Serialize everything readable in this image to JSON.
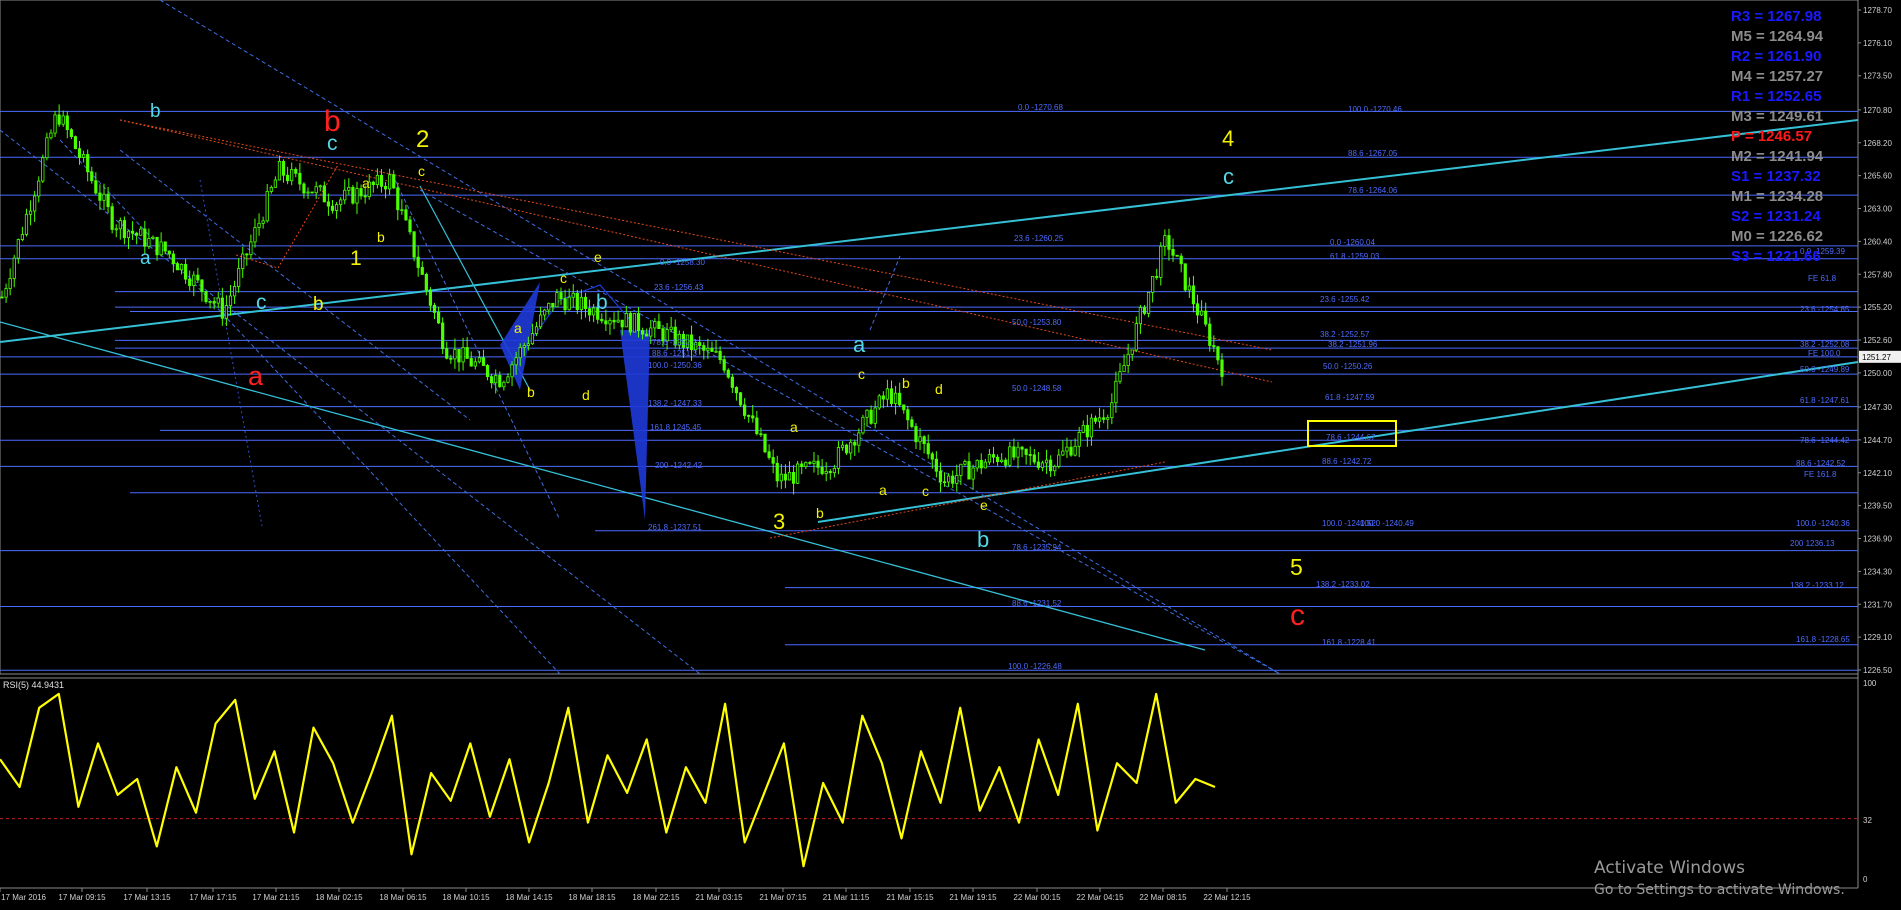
{
  "indicator": {
    "label": "RSI(5) 44.9431",
    "levels": {
      "hi": "100",
      "mid": "32",
      "lo": "0"
    }
  },
  "x_ticks": [
    "17 Mar 2016",
    "17 Mar 09:15",
    "17 Mar 13:15",
    "17 Mar 17:15",
    "17 Mar 21:15",
    "18 Mar 02:15",
    "18 Mar 06:15",
    "18 Mar 10:15",
    "18 Mar 14:15",
    "18 Mar 18:15",
    "18 Mar 22:15",
    "21 Mar 03:15",
    "21 Mar 07:15",
    "21 Mar 11:15",
    "21 Mar 15:15",
    "21 Mar 19:15",
    "22 Mar 00:15",
    "22 Mar 04:15",
    "22 Mar 08:15",
    "22 Mar 12:15"
  ],
  "pivots": [
    {
      "label": "R3 = 1267.98",
      "color": "#1a1aff"
    },
    {
      "label": "M5 = 1264.94",
      "color": "#8c8c8c"
    },
    {
      "label": "R2 = 1261.90",
      "color": "#1a1aff"
    },
    {
      "label": "M4 = 1257.27",
      "color": "#8c8c8c"
    },
    {
      "label": "R1 = 1252.65",
      "color": "#1a1aff"
    },
    {
      "label": "M3 = 1249.61",
      "color": "#8c8c8c"
    },
    {
      "label": "P = 1246.57",
      "color": "#ff1a1a"
    },
    {
      "label": "M2 = 1241.94",
      "color": "#8c8c8c"
    },
    {
      "label": "S1 = 1237.32",
      "color": "#1a1aff"
    },
    {
      "label": "M1 = 1234.28",
      "color": "#8c8c8c"
    },
    {
      "label": "S2 = 1231.24",
      "color": "#1a1aff"
    },
    {
      "label": "M0 = 1226.62",
      "color": "#8c8c8c"
    },
    {
      "label": "S3 = 1221.66",
      "color": "#1a1aff"
    }
  ],
  "wave_labels": [
    {
      "t": "b",
      "color": "#55d6e6"
    },
    {
      "t": "b",
      "color": "#ff2020"
    },
    {
      "t": "c",
      "color": "#55d6e6"
    },
    {
      "t": "2",
      "color": "#f2f200"
    },
    {
      "t": "c",
      "color": "#f2f200"
    },
    {
      "t": "a",
      "color": "#55d6e6"
    },
    {
      "t": "1",
      "color": "#f2f200"
    },
    {
      "t": "b",
      "color": "#f2f200"
    },
    {
      "t": "a",
      "color": "#f2f200"
    },
    {
      "t": "b",
      "color": "#f2f200"
    },
    {
      "t": "c",
      "color": "#55d6e6"
    },
    {
      "t": "b",
      "color": "#55d6e6"
    },
    {
      "t": "a",
      "color": "#ff2020"
    },
    {
      "t": "e",
      "color": "#f2f200"
    },
    {
      "t": "c",
      "color": "#f2f200"
    },
    {
      "t": "a",
      "color": "#f2f200"
    },
    {
      "t": "b",
      "color": "#f2f200"
    },
    {
      "t": "d",
      "color": "#f2f200"
    },
    {
      "t": "a",
      "color": "#55d6e6"
    },
    {
      "t": "c",
      "color": "#f2f200"
    },
    {
      "t": "b",
      "color": "#f2f200"
    },
    {
      "t": "d",
      "color": "#f2f200"
    },
    {
      "t": "a",
      "color": "#f2f200"
    },
    {
      "t": "a",
      "color": "#f2f200"
    },
    {
      "t": "c",
      "color": "#f2f200"
    },
    {
      "t": "e",
      "color": "#f2f200"
    },
    {
      "t": "b",
      "color": "#f2f200"
    },
    {
      "t": "3",
      "color": "#f2f200"
    },
    {
      "t": "b",
      "color": "#55d6e6"
    },
    {
      "t": "4",
      "color": "#f2f200"
    },
    {
      "t": "c",
      "color": "#55d6e6"
    },
    {
      "t": "5",
      "color": "#f2f200"
    },
    {
      "t": "c",
      "color": "#ff2020"
    }
  ],
  "fib_labels": [
    "0.0 -1270.68",
    "100.0 -1270.46",
    "88.6 -1267.05",
    "78.6 -1264.06",
    "23.6 -1260.25",
    "0.0 -1260.04",
    "0.0 -1259.39",
    "61.8 -1259.03",
    "0.0 -1258.30",
    "FE 61.8",
    "23.6 -1256.43",
    "23.6 -1255.42",
    "23.6 -1254.85",
    "50.0 -1253.80",
    "38.2 -1252.57",
    "38.2 -1252.08",
    "38.2 -1251.96",
    "FE 100.0",
    "50.0 -1250.26",
    "50.0 -1249.89",
    "50.0 -1248.58",
    "61.8 -1247.59",
    "61.8 -1247.61",
    "138.2 -1247.33",
    "161.8 1245.45",
    "78.6 -1244.67",
    "78.6 -1244.42",
    "200 -1242.42",
    "88.6 -1242.72",
    "88.6 -1242.52",
    "FE 161.8",
    "100.0 -1240.52",
    "100.0 -1240.36",
    "261.8 -1237.51",
    "78.6 -1235.94",
    "200 1236.13",
    "138.2 -1233.02",
    "138.2 -1233.12",
    "88.6 -1231.52",
    "161.8 -1228.41",
    "161.8 -1228.65",
    "100.0 -1226.48",
    "78.6 -1252.2",
    "88.6 -1251.3",
    "100.0 -1250.36",
    "100.0 -1240.49"
  ],
  "watermark": {
    "line1": "Activate Windows",
    "line2": "Go to Settings to activate Windows."
  },
  "colors": {
    "background": "#000000",
    "candles": "#4cff00",
    "rsi": "#ffff00",
    "fib": "#4d6bff",
    "trendline": "#35c0d6",
    "axis_text": "#d0d0d0",
    "highlight_box": "#ffff00"
  },
  "chart_data": [
    {
      "type": "candlestick",
      "title": "",
      "ylim": [
        1226.5,
        1279.0
      ],
      "y_ticks": [
        "1278.70",
        "1276.10",
        "1273.50",
        "1270.80",
        "1268.20",
        "1265.60",
        "1263.00",
        "1260.40",
        "1257.80",
        "1255.20",
        "1252.60",
        "1251.27",
        "1250.00",
        "1247.30",
        "1244.70",
        "1242.10",
        "1239.50",
        "1236.90",
        "1234.30",
        "1231.70",
        "1229.10",
        "1226.50"
      ],
      "current_price": 1251.27,
      "x": [
        "17 Mar 2016",
        "17 Mar 09:15",
        "17 Mar 13:15",
        "17 Mar 17:15",
        "17 Mar 21:15",
        "18 Mar 02:15",
        "18 Mar 06:15",
        "18 Mar 10:15",
        "18 Mar 14:15",
        "18 Mar 18:15",
        "18 Mar 22:15",
        "21 Mar 03:15",
        "21 Mar 07:15",
        "21 Mar 11:15",
        "21 Mar 15:15",
        "21 Mar 19:15",
        "22 Mar 00:15",
        "22 Mar 04:15",
        "22 Mar 08:15",
        "22 Mar 12:15"
      ],
      "close_path": [
        1256.0,
        1270.6,
        1262.0,
        1259.5,
        1254.8,
        1266.0,
        1263.5,
        1265.3,
        1252.0,
        1249.5,
        1256.0,
        1254.5,
        1253.0,
        1251.0,
        1241.5,
        1243.0,
        1248.5,
        1241.5,
        1243.5,
        1243.0,
        1247.5,
        1260.6,
        1250.5
      ]
    },
    {
      "type": "line",
      "title": "RSI(5) 44.9431",
      "ylim": [
        0,
        100
      ],
      "levels": [
        32
      ],
      "series": [
        {
          "name": "RSI(5)",
          "values": [
            62,
            48,
            88,
            95,
            38,
            70,
            44,
            52,
            18,
            58,
            35,
            80,
            92,
            42,
            66,
            25,
            78,
            60,
            30,
            56,
            84,
            14,
            55,
            41,
            70,
            33,
            62,
            20,
            50,
            88,
            30,
            64,
            45,
            72,
            25,
            58,
            40,
            90,
            20,
            45,
            70,
            8,
            50,
            30,
            84,
            60,
            22,
            66,
            40,
            88,
            36,
            58,
            30,
            72,
            44,
            90,
            26,
            60,
            50,
            95,
            40,
            52,
            48
          ]
        }
      ]
    }
  ]
}
